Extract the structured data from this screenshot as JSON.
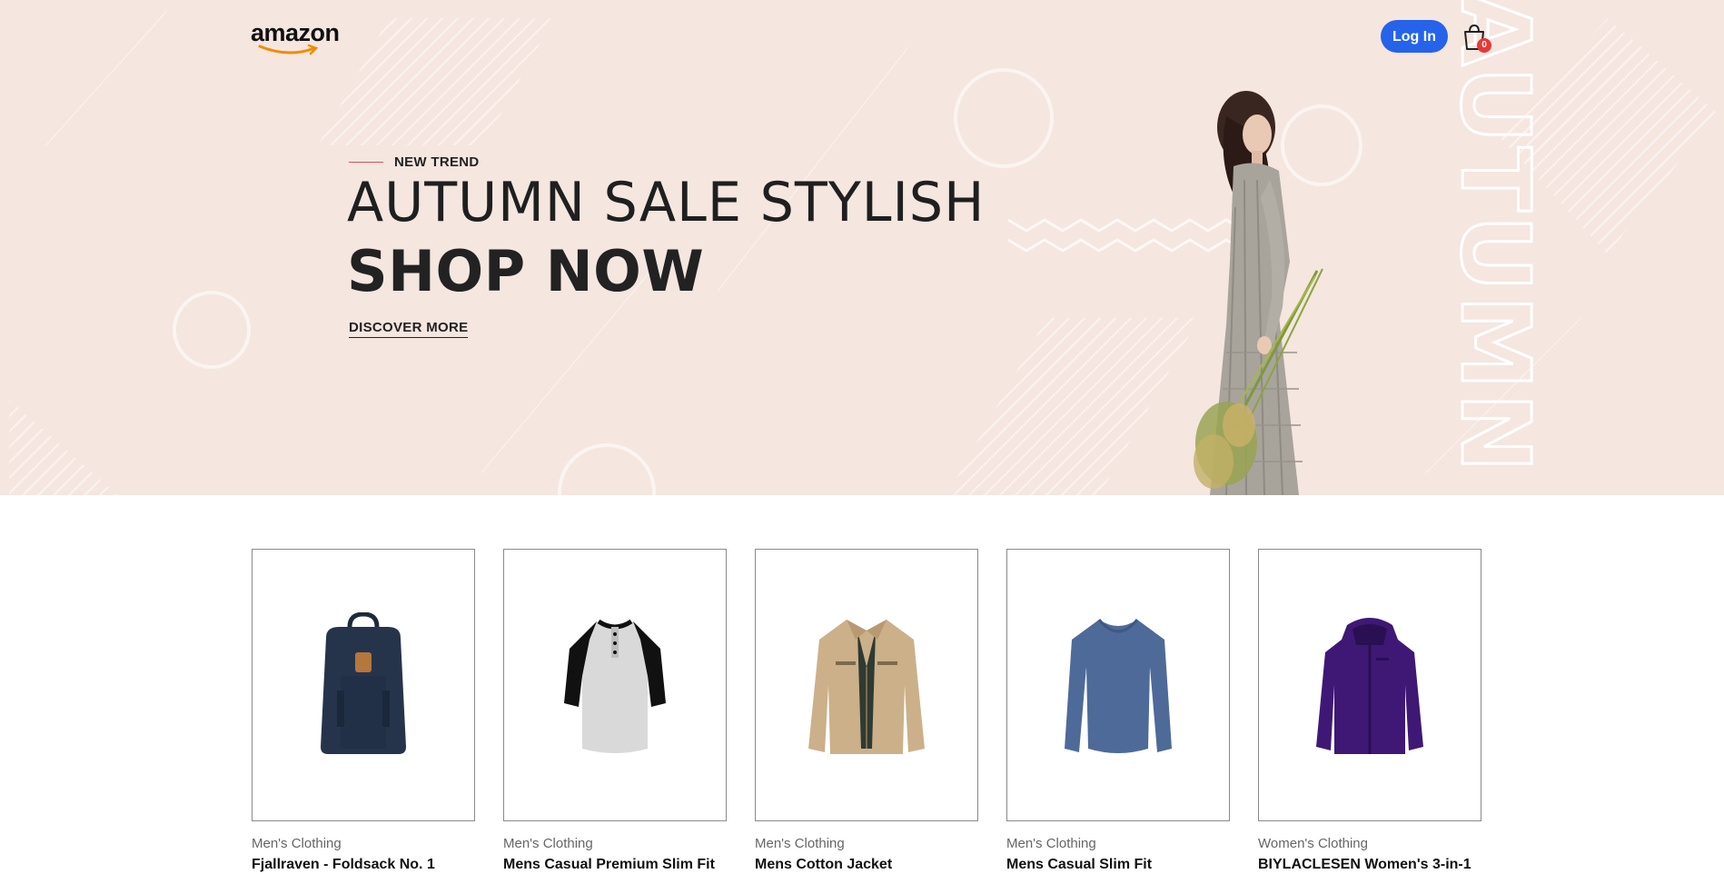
{
  "header": {
    "logo_text": "amazon",
    "login_label": "Log In",
    "cart_count": "0",
    "accent_color": "#2563eb",
    "badge_color": "#e53935"
  },
  "hero": {
    "kicker": "NEW TREND",
    "headline": "AUTUMN SALE STYLISH",
    "subheadline": "SHOP NOW",
    "cta_label": "DISCOVER MORE",
    "vertical_word": "AUTUMN",
    "background_color": "#f5e6e0"
  },
  "products": [
    {
      "category": "Men's Clothing",
      "title": "Fjallraven - Foldsack No. 1",
      "image_icon": "backpack-icon"
    },
    {
      "category": "Men's Clothing",
      "title": "Mens Casual Premium Slim Fit",
      "image_icon": "raglan-shirt-icon"
    },
    {
      "category": "Men's Clothing",
      "title": "Mens Cotton Jacket",
      "image_icon": "jacket-icon"
    },
    {
      "category": "Men's Clothing",
      "title": "Mens Casual Slim Fit",
      "image_icon": "long-sleeve-shirt-icon"
    },
    {
      "category": "Women's Clothing",
      "title": "BIYLACLESEN Women's 3-in-1",
      "image_icon": "womens-jacket-icon"
    }
  ]
}
